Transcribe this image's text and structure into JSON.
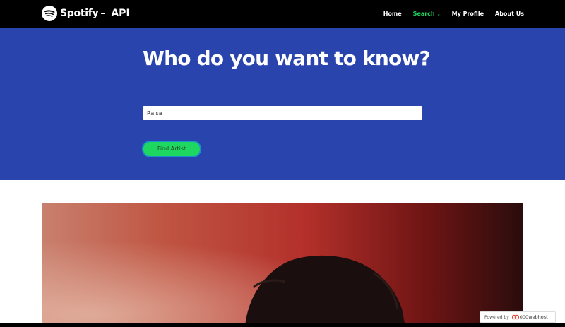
{
  "brand": {
    "name": "Spotify",
    "separator": "–",
    "suffix": "API",
    "logo_icon": "spotify-logo-icon"
  },
  "nav": {
    "items": [
      {
        "label": "Home",
        "active": false
      },
      {
        "label": "Search",
        "active": true,
        "has_dropdown": true
      },
      {
        "label": "My Profile",
        "active": false
      },
      {
        "label": "About Us",
        "active": false
      }
    ],
    "dropdown_glyph": "⌄"
  },
  "hero": {
    "title": "Who do you want to know?",
    "search_value": "Raisa",
    "button_label": "Find Artist"
  },
  "badge": {
    "prefix": "Powered by",
    "brand": "000webhost",
    "icon": "000webhost-logo-icon"
  },
  "colors": {
    "navbar": "#000000",
    "hero_bg": "#2a44ae",
    "accent": "#1ed760",
    "button_border": "#1a8fc9"
  }
}
